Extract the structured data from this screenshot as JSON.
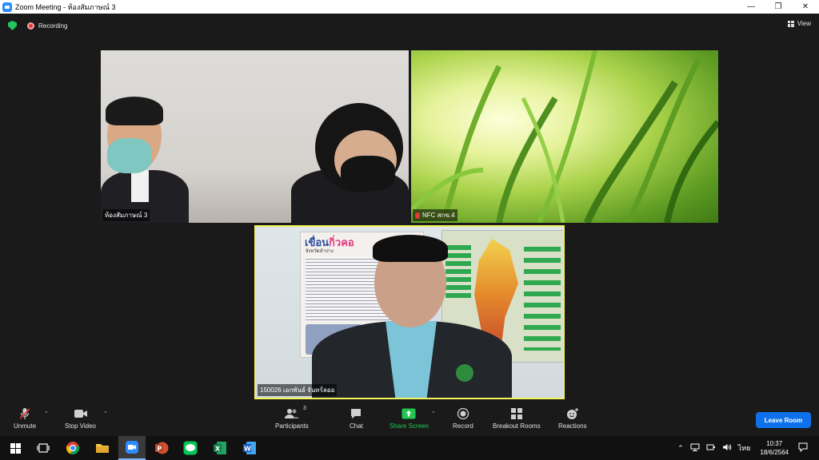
{
  "window": {
    "title": "Zoom Meeting - ห้องสัมภาษณ์ 3",
    "minimize_glyph": "—",
    "maximize_glyph": "❐",
    "close_glyph": "✕"
  },
  "topbar": {
    "recording_label": "Recording",
    "view_label": "View"
  },
  "tiles": [
    {
      "name": "ห้องสัมภาษณ์ 3"
    },
    {
      "name": "NFC สกข.4"
    },
    {
      "name": "150026 เอกพันธ์ จันทร์ลออ",
      "active_speaker": true
    }
  ],
  "poster": {
    "headline_a": "เขื่อน",
    "headline_b": "กิ่วคอ",
    "subtitle": "จังหวัดลำปาง"
  },
  "toolbar": {
    "unmute": "Unmute",
    "stop_video": "Stop Video",
    "participants": "Participants",
    "participants_count": "3",
    "chat": "Chat",
    "share_screen": "Share Screen",
    "record": "Record",
    "breakout_rooms": "Breakout Rooms",
    "reactions": "Reactions",
    "leave": "Leave Room"
  },
  "taskbar": {
    "language": "ไทย",
    "time": "10:37",
    "date": "18/6/2564"
  },
  "colors": {
    "accent": "#0e71eb",
    "share_green": "#23c552",
    "muted_red": "#e53935",
    "speaker_border": "#f2f25a"
  }
}
